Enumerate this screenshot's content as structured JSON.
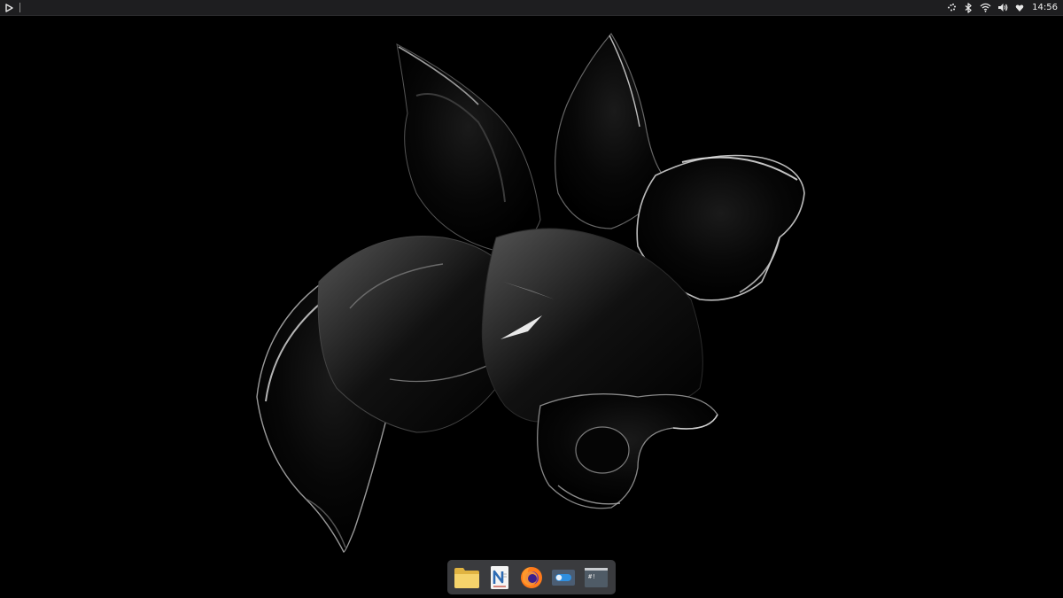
{
  "top_panel": {
    "menu_icon": "play-triangle-icon",
    "tray_icons": [
      "network-dots-icon",
      "bluetooth-icon",
      "wifi-icon",
      "volume-icon",
      "user-heart-icon"
    ],
    "clock": "14:56"
  },
  "wallpaper": {
    "description_icon": "abstract-black-glossy-shape"
  },
  "dock": {
    "items": [
      "file-manager-icon",
      "text-editor-icon",
      "firefox-icon",
      "settings-toggle-icon",
      "terminal-icon"
    ],
    "terminal_prompt": "#!"
  },
  "colors": {
    "panel_bg": "#1e1e20",
    "dock_bg": "#3a3b3e",
    "folder_yellow": "#f2c94c",
    "firefox_orange": "#ff7a1a",
    "toggle_blue": "#2f8fe0"
  }
}
